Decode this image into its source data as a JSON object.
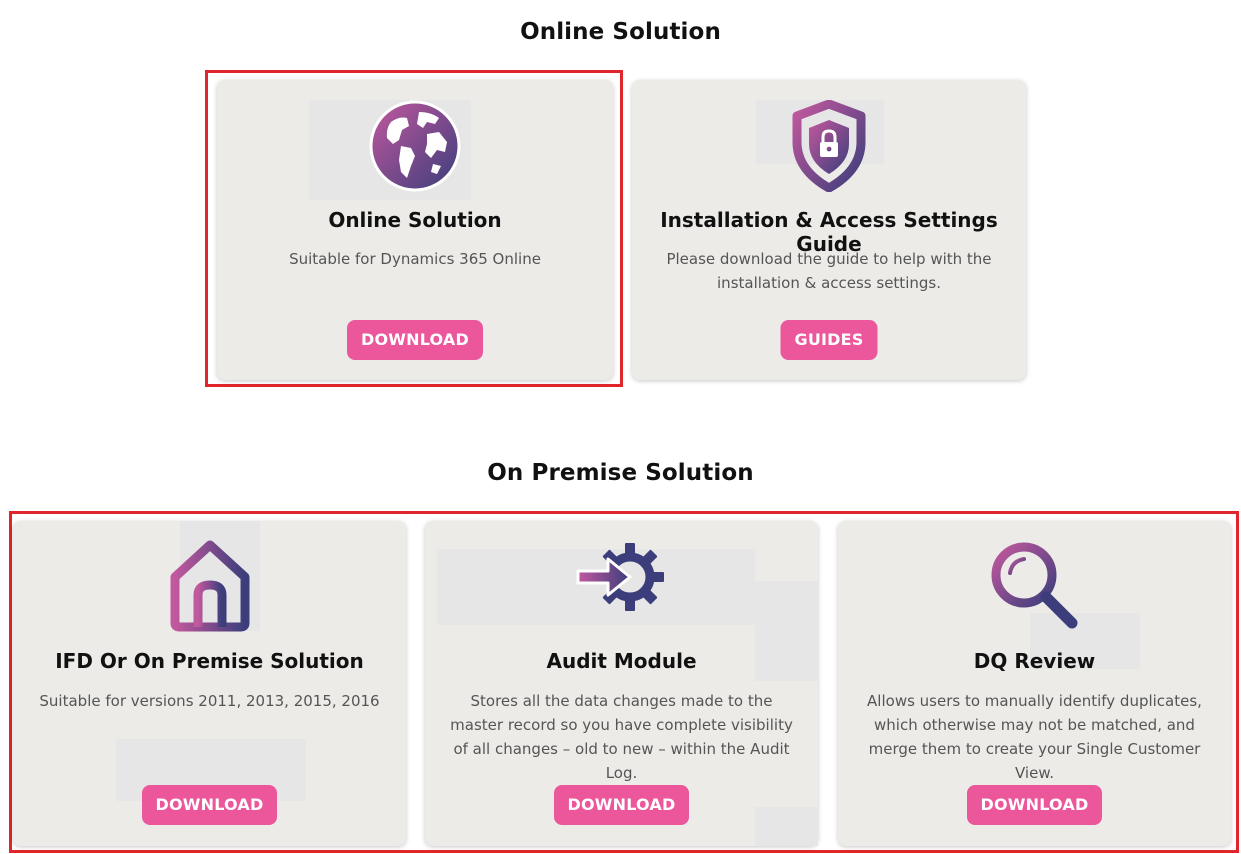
{
  "colors": {
    "accent": "#ec579c",
    "highlight": "#e0262a",
    "card_bg": "#ecebe8",
    "icon_gradient_start": "#b0569a",
    "icon_gradient_end": "#3c3f7c"
  },
  "online_section": {
    "title": "Online Solution",
    "cards": [
      {
        "icon": "globe-icon",
        "title": "Online Solution",
        "description": "Suitable for Dynamics 365 Online",
        "button": "DOWNLOAD"
      },
      {
        "icon": "shield-lock-icon",
        "title": "Installation & Access Settings Guide",
        "description": "Please download the guide to help with the installation & access settings.",
        "button": "GUIDES"
      }
    ]
  },
  "onprem_section": {
    "title": "On Premise Solution",
    "cards": [
      {
        "icon": "home-icon",
        "title": "IFD Or On Premise Solution",
        "description": "Suitable for versions 2011, 2013, 2015, 2016",
        "button": "DOWNLOAD"
      },
      {
        "icon": "arrow-gear-icon",
        "title": "Audit Module",
        "description": "Stores all the data changes made to the master record so you have complete visibility of all changes – old to new – within the Audit Log.",
        "button": "DOWNLOAD"
      },
      {
        "icon": "magnifier-icon",
        "title": "DQ Review",
        "description": "Allows users to manually identify duplicates, which otherwise may not be matched, and merge them to create your Single Customer View.",
        "button": "DOWNLOAD"
      }
    ]
  }
}
